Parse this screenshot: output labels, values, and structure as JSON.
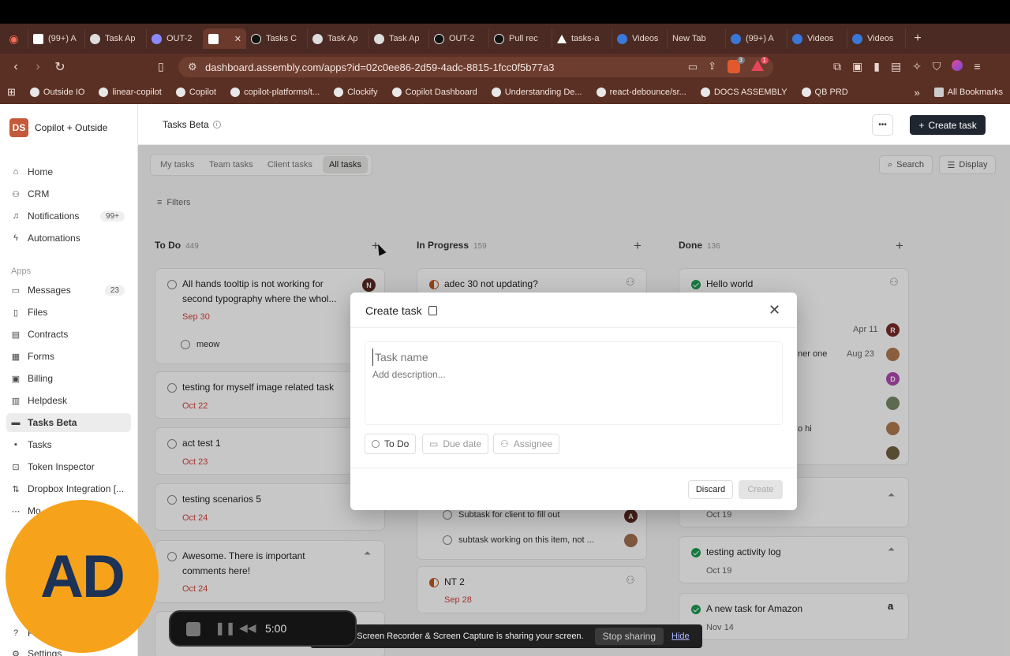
{
  "browser": {
    "tabs": [
      {
        "label": "(99+) A",
        "icon": "ticket-icon"
      },
      {
        "label": "Task Ap",
        "icon": "globe-icon"
      },
      {
        "label": "OUT-2",
        "icon": "linear-icon"
      },
      {
        "label": "",
        "icon": "ticket-icon"
      },
      {
        "label": "Tasks C",
        "icon": "github-icon"
      },
      {
        "label": "Task Ap",
        "icon": "globe-icon"
      },
      {
        "label": "Task Ap",
        "icon": "globe-icon"
      },
      {
        "label": "OUT-2",
        "icon": "github-icon"
      },
      {
        "label": "Pull rec",
        "icon": "github-icon"
      },
      {
        "label": "tasks-a",
        "icon": "vercel-icon"
      },
      {
        "label": "Videos",
        "icon": "gear-icon"
      },
      {
        "label": "New Tab",
        "icon": ""
      },
      {
        "label": "(99+) A",
        "icon": "gear-icon"
      },
      {
        "label": "Videos",
        "icon": "gear-icon"
      },
      {
        "label": "Videos",
        "icon": "gear-icon"
      }
    ],
    "url": "dashboard.assembly.com/apps?id=02c0ee86-2d59-4adc-8815-1fcc0f5b77a3",
    "bookmarks": [
      "Outside IO",
      "linear-copilot",
      "Copilot",
      "copilot-platforms/t...",
      "Clockify",
      "Copilot Dashboard",
      "Understanding De...",
      "react-debounce/sr...",
      "DOCS ASSEMBLY",
      "QB PRD"
    ],
    "all_bookmarks": "All Bookmarks",
    "shield_badge": "3",
    "warn_badge": "1"
  },
  "sidebar": {
    "workspace_logo": "DS",
    "workspace": "Copilot + Outside",
    "top_items": [
      {
        "label": "Home",
        "icon": "home-icon"
      },
      {
        "label": "CRM",
        "icon": "users-icon"
      },
      {
        "label": "Notifications",
        "icon": "bell-icon",
        "badge": "99+"
      },
      {
        "label": "Automations",
        "icon": "bolt-icon"
      }
    ],
    "apps_label": "Apps",
    "apps": [
      {
        "label": "Messages",
        "badge": "23"
      },
      {
        "label": "Files"
      },
      {
        "label": "Contracts"
      },
      {
        "label": "Forms"
      },
      {
        "label": "Billing"
      },
      {
        "label": "Helpdesk"
      },
      {
        "label": "Tasks Beta",
        "active": true
      },
      {
        "label": "Tasks"
      },
      {
        "label": "Token Inspector"
      },
      {
        "label": "Dropbox Integration [..."
      },
      {
        "label": "Mo"
      }
    ],
    "bottom": [
      "Fi",
      "Settings"
    ]
  },
  "header": {
    "title": "Tasks Beta",
    "more": "•••",
    "create": "Create task"
  },
  "filters": {
    "tabs": [
      "My tasks",
      "Team tasks",
      "Client tasks",
      "All tasks"
    ],
    "active": "All tasks",
    "filters_label": "Filters",
    "search": "Search",
    "display": "Display"
  },
  "columns": [
    {
      "title": "To Do",
      "count": "449"
    },
    {
      "title": "In Progress",
      "count": "159"
    },
    {
      "title": "Done",
      "count": "136"
    }
  ],
  "todo_cards": [
    {
      "title_l1": "All hands tooltip is not working for",
      "title_l2": "second typography where the whol...",
      "date": "Sep 30",
      "sub": "meow",
      "avatar": "N"
    },
    {
      "title_l1": "testing for myself image related task",
      "date": "Oct 22"
    },
    {
      "title_l1": "act test 1",
      "date": "Oct 23"
    },
    {
      "title_l1": "testing scenarios 5",
      "date": "Oct 24"
    },
    {
      "title_l1": "Awesome. There is important",
      "title_l2": "comments here!",
      "date": "Oct 24"
    }
  ],
  "progress_cards": [
    {
      "title": "adec 30 not updating?"
    },
    {
      "sub1": "Subtask for client to fill out",
      "sub1_avatar": "A",
      "sub2": "subtask working on this item, not ..."
    },
    {
      "title": "NT 2",
      "date": "Sep 28"
    }
  ],
  "done_cards": [
    {
      "title": "Hello world",
      "date": "Apr 11",
      "avatar": "R",
      "frag": "ner one",
      "frag_date": "Aug 23",
      "avatar2": "D",
      "frag2": "o hi"
    },
    {
      "date": "Oct 19"
    },
    {
      "title": "testing activity log",
      "date": "Oct 19"
    },
    {
      "title": "A new task for Amazon",
      "date": "Nov 14"
    }
  ],
  "modal": {
    "title": "Create task",
    "name_placeholder": "Task name",
    "desc_placeholder": "Add description...",
    "status": "To Do",
    "due": "Due date",
    "assignee": "Assignee",
    "discard": "Discard",
    "create": "Create"
  },
  "loom": {
    "message": "Loom – Screen Recorder & Screen Capture is sharing your screen.",
    "stop": "Stop sharing",
    "hide": "Hide",
    "timer": "5:00",
    "initials": "AD"
  }
}
